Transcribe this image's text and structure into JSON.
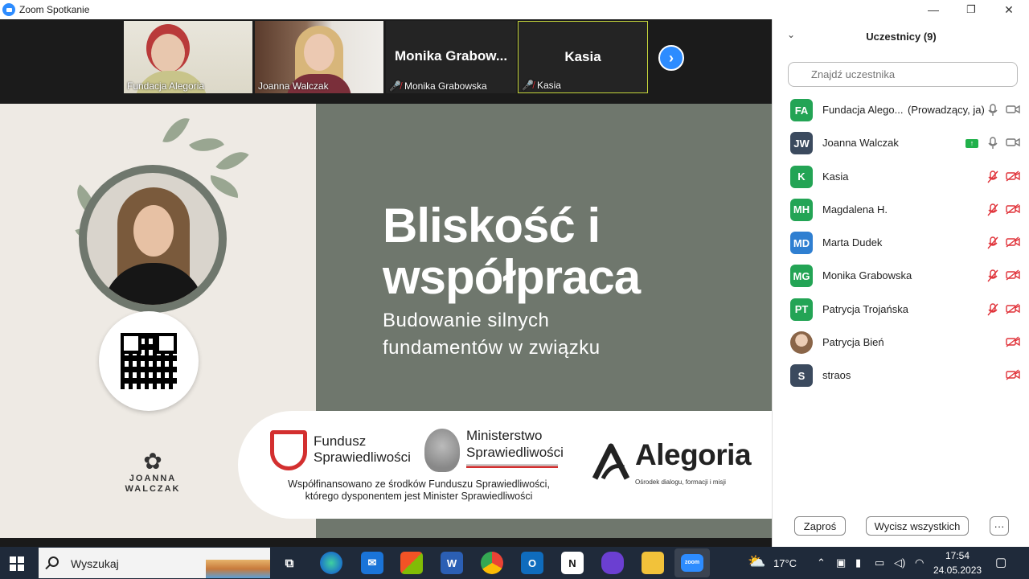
{
  "window": {
    "title": "Zoom Spotkanie",
    "minimize": "—",
    "restore": "❐",
    "close": "✕"
  },
  "gallery": {
    "tiles": [
      {
        "name": "Fundacja Alegoria"
      },
      {
        "name": "Joanna Walczak"
      },
      {
        "name": "Monika Grabowska",
        "display": "Monika  Grabow..."
      },
      {
        "name": "Kasia",
        "display": "Kasia"
      }
    ],
    "next_icon": "›"
  },
  "slide": {
    "headline_line1": "Bliskość i",
    "headline_line2": "współpraca",
    "subline_line1": "Budowanie silnych",
    "subline_line2": "fundamentów w związku",
    "jw_logo_line1": "JOANNA",
    "jw_logo_line2": "WALCZAK",
    "fs_line1": "Fundusz",
    "fs_line2": "Sprawiedliwości",
    "ms_line1": "Ministerstwo",
    "ms_line2": "Sprawiedliwości",
    "cofund_line1": "Współfinansowano ze środków Funduszu Sprawiedliwości,",
    "cofund_line2": "którego dysponentem jest Minister Sprawiedliwości",
    "alegoria_name": "Alegoria",
    "alegoria_sub": "Ośrodek dialogu, formacji i misji"
  },
  "panel": {
    "title": "Uczestnicy (9)",
    "collapse_icon": "⌄",
    "search_placeholder": "Znajdź uczestnika",
    "participants": [
      {
        "initials": "FA",
        "name": "Fundacja Alego...",
        "role": "(Prowadzący, ja)",
        "color": "#23a455",
        "mic": "on",
        "cam": "on"
      },
      {
        "initials": "JW",
        "name": "Joanna Walczak",
        "role": "",
        "color": "#3b4a5e",
        "mic": "on",
        "cam": "on",
        "sharing": true
      },
      {
        "initials": "K",
        "name": "Kasia",
        "role": "",
        "color": "#23a455",
        "mic": "off",
        "cam": "off"
      },
      {
        "initials": "MH",
        "name": "Magdalena H.",
        "role": "",
        "color": "#23a455",
        "mic": "off",
        "cam": "off"
      },
      {
        "initials": "MD",
        "name": "Marta Dudek",
        "role": "",
        "color": "#2f7fd1",
        "mic": "off",
        "cam": "off"
      },
      {
        "initials": "MG",
        "name": "Monika Grabowska",
        "role": "",
        "color": "#23a455",
        "mic": "off",
        "cam": "off"
      },
      {
        "initials": "PT",
        "name": "Patrycja Trojańska",
        "role": "",
        "color": "#23a455",
        "mic": "off",
        "cam": "off"
      },
      {
        "initials": "",
        "name": "Patrycja Bień",
        "role": "",
        "color": "#c9a98c",
        "mic": "none",
        "cam": "off",
        "photo": true
      },
      {
        "initials": "S",
        "name": "straos",
        "role": "",
        "color": "#3b4a5e",
        "mic": "none",
        "cam": "off"
      }
    ],
    "invite_label": "Zaproś",
    "mute_all_label": "Wycisz wszystkich",
    "more_label": "···"
  },
  "taskbar": {
    "search_label": "Wyszukaj",
    "weather_temp": "17°C",
    "time": "17:54",
    "date": "24.05.2023"
  },
  "colors": {
    "zoom_blue": "#2d8cff",
    "slide_green": "#6f776d",
    "muted_red": "#e0333a",
    "taskbar": "#1f2a3a"
  }
}
